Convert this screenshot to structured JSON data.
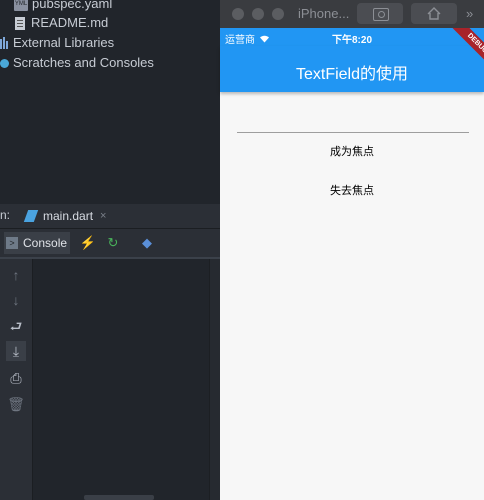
{
  "project_tree": {
    "items": [
      {
        "label": "pubspec.yaml",
        "icon": "yaml-file-icon"
      },
      {
        "label": "README.md",
        "icon": "text-file-icon"
      },
      {
        "label": "External Libraries",
        "icon": "library-icon"
      },
      {
        "label": "Scratches and Consoles",
        "icon": "scratches-icon"
      }
    ],
    "yaml_badge": "YML"
  },
  "run_panel": {
    "prefix": "n:",
    "file_tab": "main.dart",
    "close": "×",
    "console_tab": "Console"
  },
  "simulator": {
    "window_title": "iPhone...",
    "chevron": "»",
    "status_bar": {
      "carrier": "运营商",
      "time": "下午8:20"
    },
    "app_bar_title": "TextField的使用",
    "debug_banner": "DEBUG",
    "buttons": [
      "成为焦点",
      "失去焦点"
    ]
  },
  "colors": {
    "accent": "#2196f3",
    "ide_bg": "#21252b",
    "debug": "#a8232a"
  }
}
